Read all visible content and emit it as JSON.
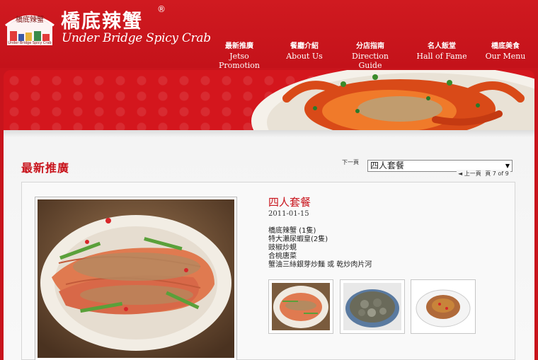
{
  "brand": {
    "name_cn": "橋底辣蟹",
    "name_en": "Under Bridge Spicy Crab",
    "registered": "®",
    "emblem_text": "橋底辣蟹",
    "emblem_sub": "Under Bridge Spicy Crab"
  },
  "nav": [
    {
      "cn": "最新推廣",
      "en": "Jetso Promotion"
    },
    {
      "cn": "餐廳介紹",
      "en": "About Us"
    },
    {
      "cn": "分店指南",
      "en": "Direction Guide"
    },
    {
      "cn": "名人飯堂",
      "en": "Hall of Fame"
    },
    {
      "cn": "橋底美食",
      "en": "Our Menu"
    }
  ],
  "section": {
    "title": "最新推廣"
  },
  "pager": {
    "next_label": "下一頁",
    "prev_label": "上一頁",
    "selected": "四人套餐",
    "count": "頁 7 of 9"
  },
  "item": {
    "title": "四人套餐",
    "date": "2011-01-15",
    "menu": [
      "橋底辣蟹 (1隻)",
      "特大瀨尿蝦皇(2隻)",
      "豉椒炒蜆",
      "合桃唐菜",
      "蟹油三絲銀芽炒麵 或 乾炒肉片河"
    ]
  },
  "colors": {
    "brand_red": "#c8141c",
    "title_red": "#c8141c"
  }
}
